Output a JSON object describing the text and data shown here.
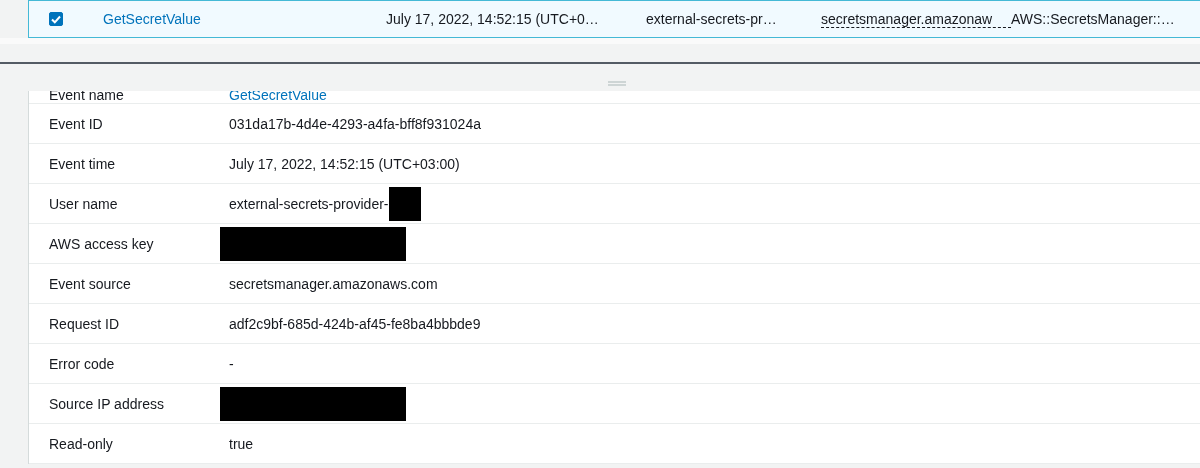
{
  "event_row": {
    "checked": true,
    "selected": true,
    "cells": [
      {
        "text": "GetSecretValue",
        "kind": "link"
      },
      {
        "text": "July 17, 2022, 14:52:15 (UTC+0…",
        "kind": "plain"
      },
      {
        "text": "external-secrets-pr…",
        "kind": "plain"
      },
      {
        "text": "secretsmanager.amazonaw",
        "kind": "dashed"
      },
      {
        "text": "AWS::SecretsManager::…",
        "kind": "plain"
      }
    ]
  },
  "details": [
    {
      "label": "Event name",
      "value": "GetSecretValue",
      "kind": "link"
    },
    {
      "label": "Event ID",
      "value": "031da17b-4d4e-4293-a4fa-bff8f931024a",
      "kind": "text"
    },
    {
      "label": "Event time",
      "value": "July 17, 2022, 14:52:15 (UTC+03:00)",
      "kind": "text"
    },
    {
      "label": "User name",
      "value": "external-secrets-provider-",
      "kind": "partly_redacted"
    },
    {
      "label": "AWS access key",
      "kind": "redacted"
    },
    {
      "label": "Event source",
      "value": "secretsmanager.amazonaws.com",
      "kind": "text"
    },
    {
      "label": "Request ID",
      "value": "adf2c9bf-685d-424b-af45-fe8ba4bbbde9",
      "kind": "text"
    },
    {
      "label": "Error code",
      "value": "-",
      "kind": "text"
    },
    {
      "label": "Source IP address",
      "kind": "redacted"
    },
    {
      "label": "Read-only",
      "value": "true",
      "kind": "text"
    }
  ]
}
